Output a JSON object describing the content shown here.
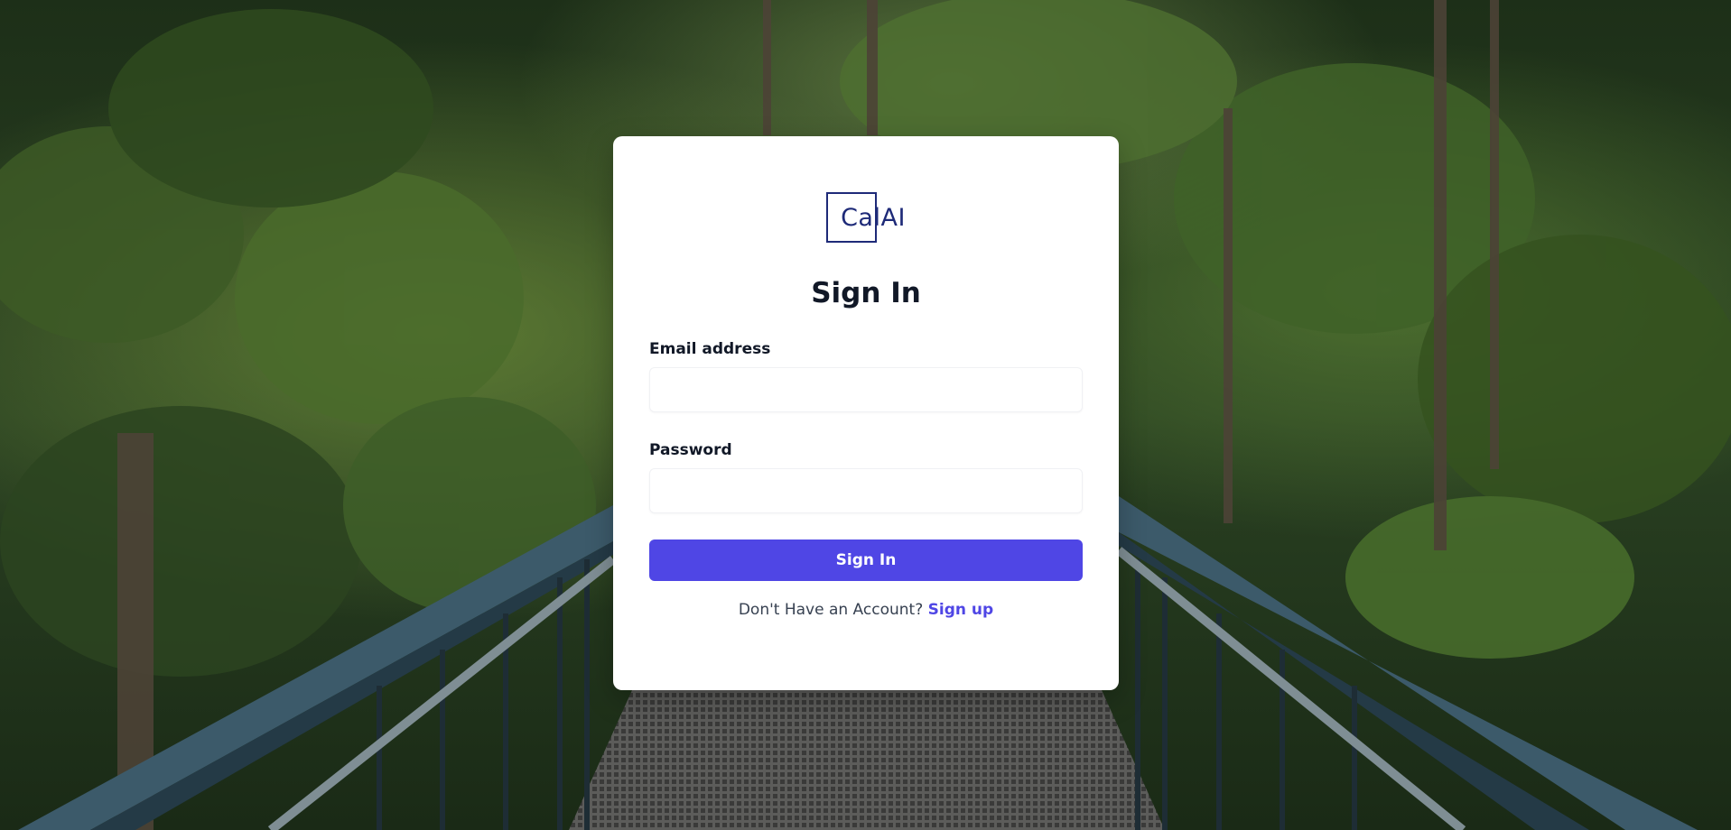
{
  "brand": {
    "logo_text": "CalAI",
    "logo_color": "#1e2a78"
  },
  "form": {
    "title": "Sign In",
    "email_label": "Email address",
    "email_value": "",
    "password_label": "Password",
    "password_value": "",
    "submit_label": "Sign In",
    "accent_color": "#4f46e5"
  },
  "footer": {
    "prompt_text": "Don't Have an Account?",
    "signup_link": "Sign up"
  },
  "background": {
    "description_icon": "forest-bridge-photo"
  }
}
